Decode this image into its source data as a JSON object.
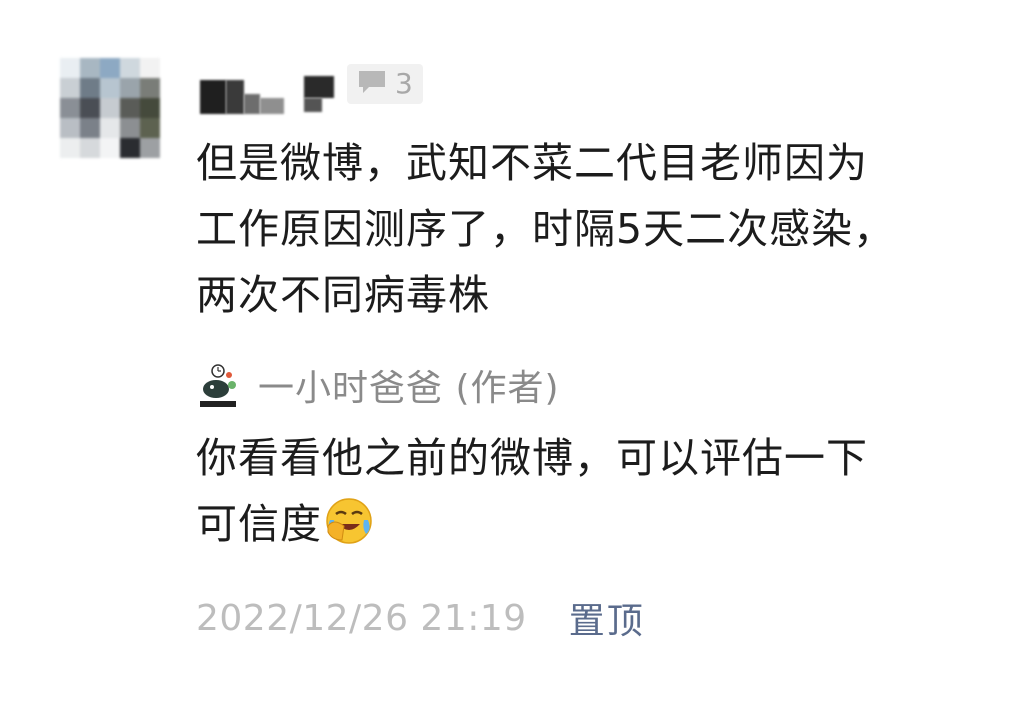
{
  "comment": {
    "reply_count": "3",
    "text": "但是微博，武知不菜二代目老师因为\n工作原因测序了，时隔5天二次感染，\n两次不同病毒株",
    "icons": {
      "avatar": "pixelated-avatar-icon",
      "reply": "speech-bubble-icon"
    }
  },
  "author_reply": {
    "author_name": "一小时爸爸 (作者)",
    "line1": "你看看他之前的微博，可以评估一下",
    "line2": "可信度",
    "emoji": "laughing-crying-face-icon"
  },
  "footer": {
    "timestamp": "2022/12/26 21:19",
    "pin_label": "置顶"
  },
  "colors": {
    "body_text": "#1c1c1c",
    "meta_text": "#8a8a8a",
    "timestamp": "#bdbdbd",
    "link": "#5a6b8c"
  }
}
